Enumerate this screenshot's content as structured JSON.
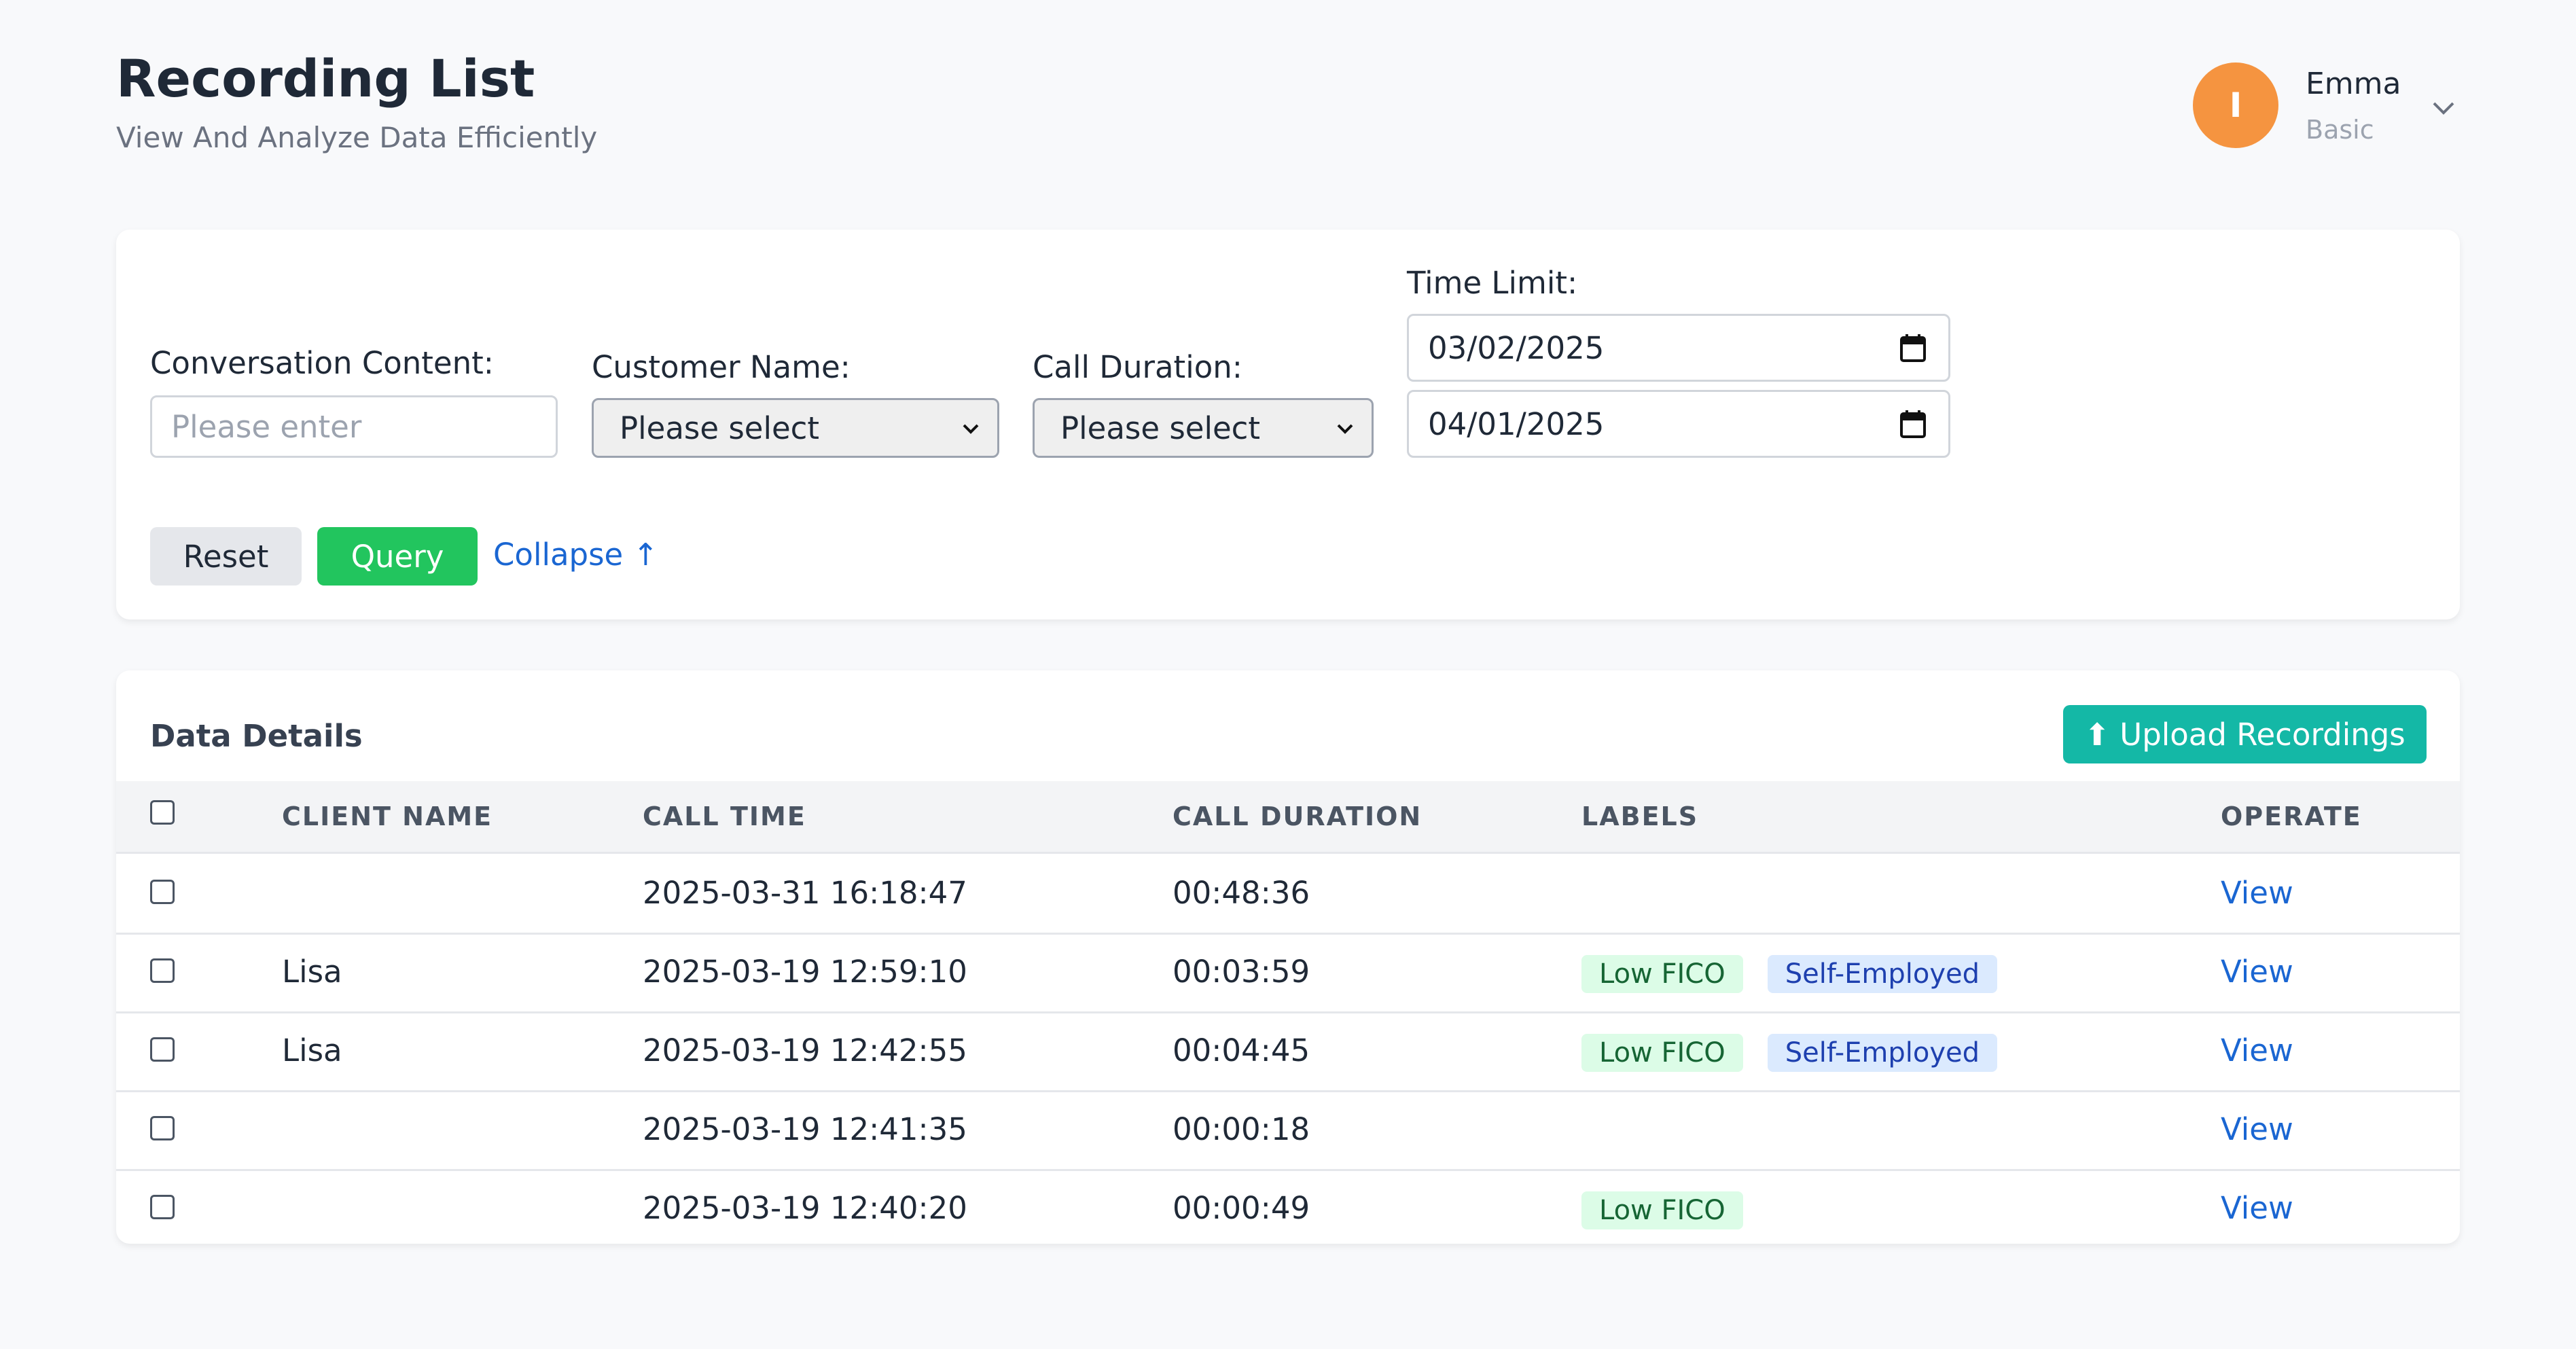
{
  "header": {
    "title": "Recording List",
    "subtitle": "View And Analyze Data Efficiently"
  },
  "user": {
    "initial": "I",
    "name": "Emma",
    "plan": "Basic",
    "avatar_color": "#f59440"
  },
  "filters": {
    "conversation_content": {
      "label": "Conversation Content:",
      "placeholder": "Please enter",
      "value": ""
    },
    "customer_name": {
      "label": "Customer Name:",
      "value": "Please select"
    },
    "call_duration": {
      "label": "Call Duration:",
      "value": "Please select"
    },
    "time_limit": {
      "label": "Time Limit:",
      "start": "03/02/2025",
      "end": "04/01/2025"
    },
    "reset_label": "Reset",
    "query_label": "Query",
    "collapse_label": "Collapse ↑"
  },
  "data_section": {
    "title": "Data Details",
    "upload_label": "⬆ Upload Recordings",
    "columns": [
      "CLIENT NAME",
      "CALL TIME",
      "CALL DURATION",
      "LABELS",
      "OPERATE"
    ],
    "rows": [
      {
        "client": "",
        "time": "2025-03-31 16:18:47",
        "duration": "00:48:36",
        "labels": [],
        "action": "View"
      },
      {
        "client": "Lisa",
        "time": "2025-03-19 12:59:10",
        "duration": "00:03:59",
        "labels": [
          "Low FICO",
          "Self-Employed"
        ],
        "action": "View"
      },
      {
        "client": "Lisa",
        "time": "2025-03-19 12:42:55",
        "duration": "00:04:45",
        "labels": [
          "Low FICO",
          "Self-Employed"
        ],
        "action": "View"
      },
      {
        "client": "",
        "time": "2025-03-19 12:41:35",
        "duration": "00:00:18",
        "labels": [],
        "action": "View"
      },
      {
        "client": "",
        "time": "2025-03-19 12:40:20",
        "duration": "00:00:49",
        "labels": [
          "Low FICO"
        ],
        "action": "View"
      }
    ]
  },
  "colors": {
    "query": "#22c55e",
    "upload": "#14b8a6",
    "link": "#1a66d2",
    "tag_green_bg": "#dcfce7",
    "tag_blue_bg": "#dbeafe"
  },
  "icons": {
    "user_menu": "chevron-down-icon",
    "date_picker": "calendar-icon",
    "select": "chevron-down-icon",
    "upload": "upload-arrow-icon"
  }
}
